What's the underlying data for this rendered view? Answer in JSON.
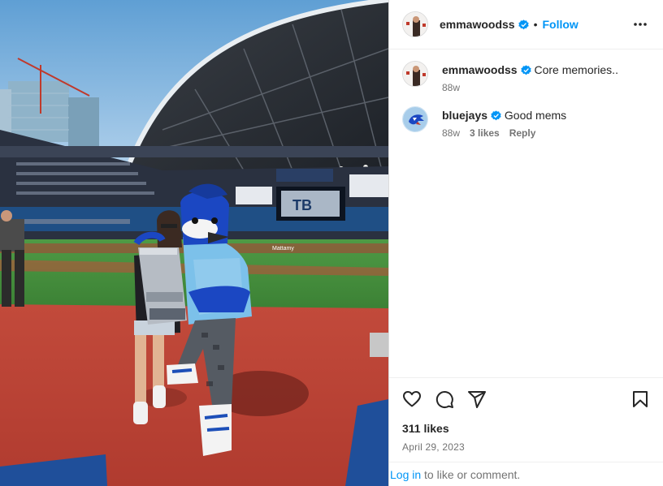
{
  "post": {
    "owner": {
      "username": "emmawoodss",
      "verified": true,
      "follow_label": "Follow",
      "separator": "•"
    },
    "photo": {
      "scoreboard_text": "TB",
      "sign_text": "Mattamy"
    },
    "comments": [
      {
        "username": "emmawoodss",
        "verified": true,
        "text": "Core memories..",
        "age": "88w"
      },
      {
        "username": "bluejays",
        "verified": true,
        "text": "Good mems",
        "age": "88w",
        "likes": "3 likes",
        "reply_label": "Reply"
      }
    ],
    "likes": "311 likes",
    "date": "April 29, 2023",
    "login": {
      "link": "Log in",
      "rest": " to like or comment."
    }
  },
  "colors": {
    "accent": "#0095f6",
    "text": "#262626",
    "secondary": "#737373",
    "field": "#c0493a",
    "grass": "#3f8a3a"
  },
  "icons": [
    "more-options-icon",
    "verified-icon",
    "heart-icon",
    "comment-icon",
    "share-icon",
    "bookmark-icon"
  ]
}
